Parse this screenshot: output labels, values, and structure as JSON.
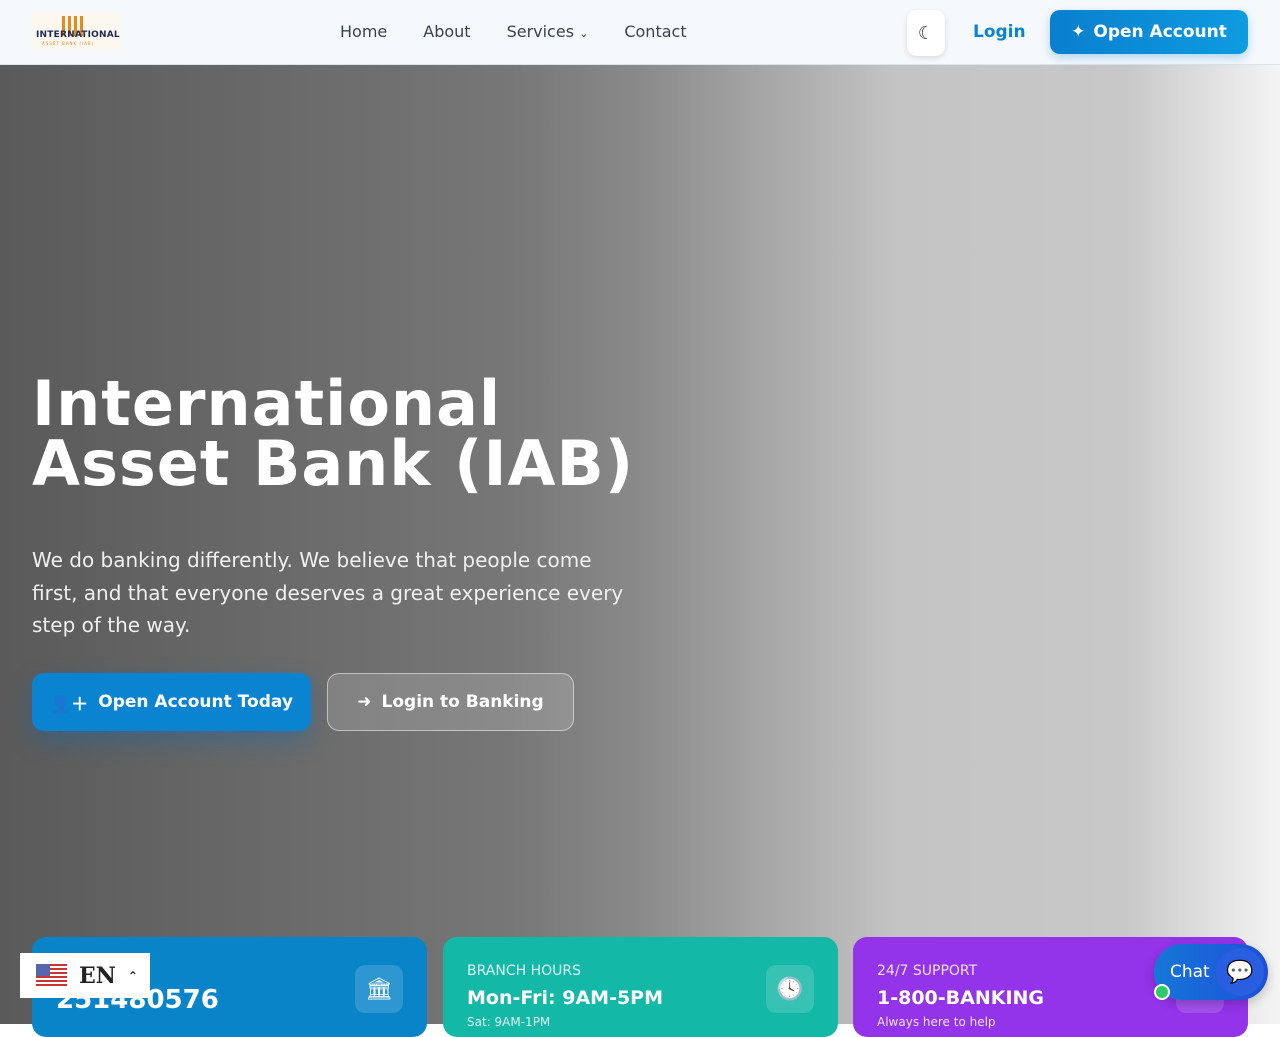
{
  "header": {
    "logo_text": "INTERNATIONAL",
    "logo_sub": "ASSET BANK (IAB)",
    "nav": [
      "Home",
      "About",
      "Services",
      "Contact"
    ],
    "login": "Login",
    "open_account": "Open Account"
  },
  "hero": {
    "title_line1": "International",
    "title_line2": "Asset Bank (IAB)",
    "description": "We do banking differently. We believe that people come first, and that everyone deserves a great experience every step of the way.",
    "primary_button": "Open Account Today",
    "secondary_button": "Login to Banking"
  },
  "cards": [
    {
      "label": "",
      "value": "251480576",
      "sub": ""
    },
    {
      "label": "BRANCH HOURS",
      "value": "Mon-Fri: 9AM-5PM",
      "sub": "Sat: 9AM-1PM"
    },
    {
      "label": "24/7 SUPPORT",
      "value": "1-800-BANKING",
      "sub": "Always here to help"
    }
  ],
  "language": {
    "code": "EN"
  },
  "chat": {
    "label": "Chat"
  },
  "colors": {
    "primary": "#0a84d0",
    "teal": "#14b8a6",
    "purple": "#9333ea"
  }
}
